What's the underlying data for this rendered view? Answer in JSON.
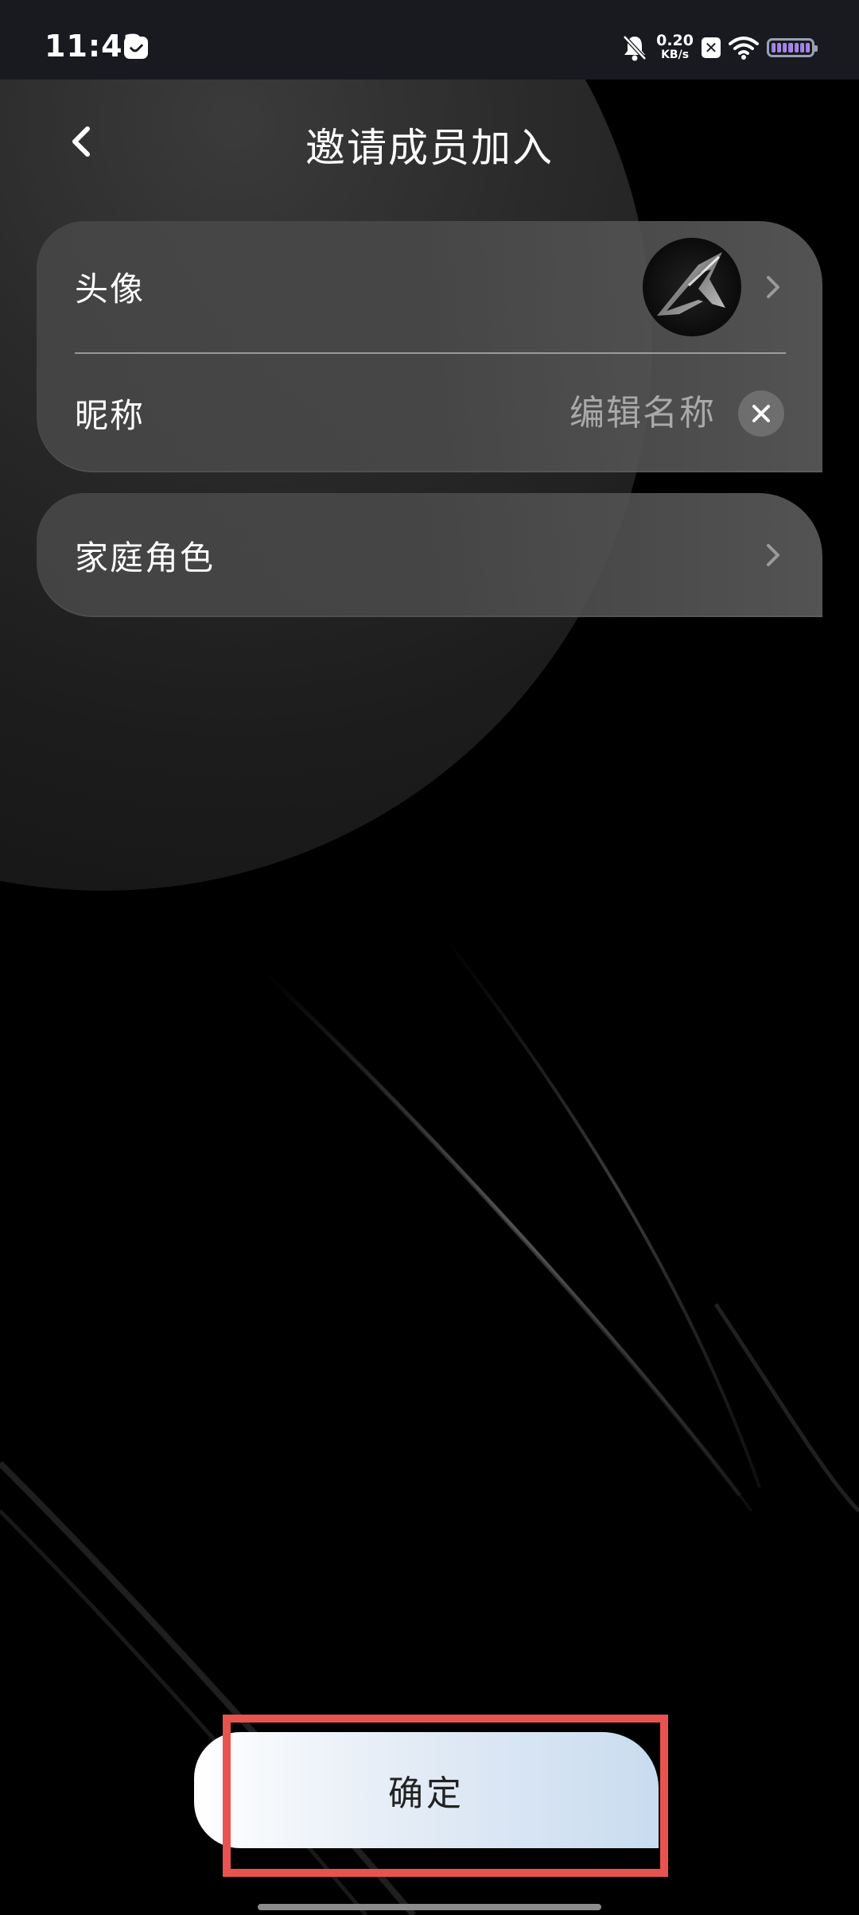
{
  "status_bar": {
    "time": "11:42",
    "net_speed_value": "0.20",
    "net_speed_unit": "KB/s",
    "x_badge": "✕"
  },
  "header": {
    "title": "邀请成员加入"
  },
  "profile_card": {
    "avatar_label": "头像",
    "nickname_label": "昵称",
    "nickname_value": "",
    "nickname_placeholder": "编辑名称"
  },
  "role_card": {
    "role_label": "家庭角色"
  },
  "footer": {
    "confirm_label": "确定"
  },
  "colors": {
    "highlight": "#e8534f",
    "confirm_gradient_end": "#c9dcf0",
    "status_bar_bg": "#181a20"
  },
  "icons": {
    "back": "chevron-left-icon",
    "row_arrow": "chevron-right-icon",
    "clear": "close-icon"
  }
}
